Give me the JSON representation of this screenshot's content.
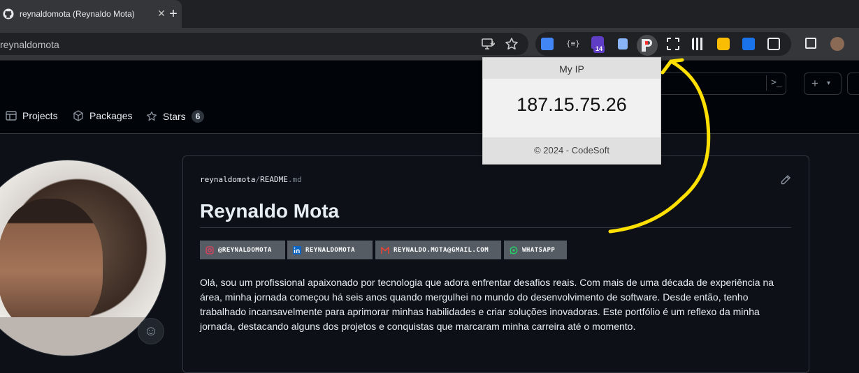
{
  "browser": {
    "tab_title": "reynaldomota (Reynaldo Mota)",
    "tab_close": "✕",
    "new_tab": "+",
    "url": "reynaldomota",
    "extension_badge": "14"
  },
  "github": {
    "nav": [
      {
        "label": "Projects"
      },
      {
        "label": "Packages"
      },
      {
        "label": "Stars",
        "count": "6"
      }
    ],
    "command_label": ">_",
    "plus_label": "+"
  },
  "popup": {
    "header": "My IP",
    "ip": "187.15.75.26",
    "footer": "© 2024 - CodeSoft"
  },
  "readme": {
    "owner": "reynaldomota",
    "separator": "/",
    "file_name": "README",
    "file_ext": ".md",
    "title": "Reynaldo Mota",
    "badges": [
      {
        "label": "@REYNALDOMOTA",
        "icon": "instagram-icon",
        "color": "#e4405f"
      },
      {
        "label": "REYNALDOMOTA",
        "icon": "linkedin-icon",
        "color": "#0a66c2"
      },
      {
        "label": "REYNALDO.MOTA@GMAIL.COM",
        "icon": "gmail-icon",
        "color": "#ea4335"
      },
      {
        "label": "WHATSAPP",
        "icon": "whatsapp-icon",
        "color": "#25d366"
      }
    ],
    "bio": "Olá, sou um profissional apaixonado por tecnologia que adora enfrentar desafios reais. Com mais de uma década de experiência na área, minha jornada começou há seis anos quando mergulhei no mundo do desenvolvimento de software. Desde então, tenho trabalhado incansavelmente para aprimorar minhas habilidades e criar soluções inovadoras. Este portfólio é um reflexo da minha jornada, destacando alguns dos projetos e conquistas que marcaram minha carreira até o momento."
  },
  "colors": {
    "annotation_arrow": "#ffe000",
    "github_bg": "#0d1117",
    "chrome_toolbar": "#35363a"
  }
}
